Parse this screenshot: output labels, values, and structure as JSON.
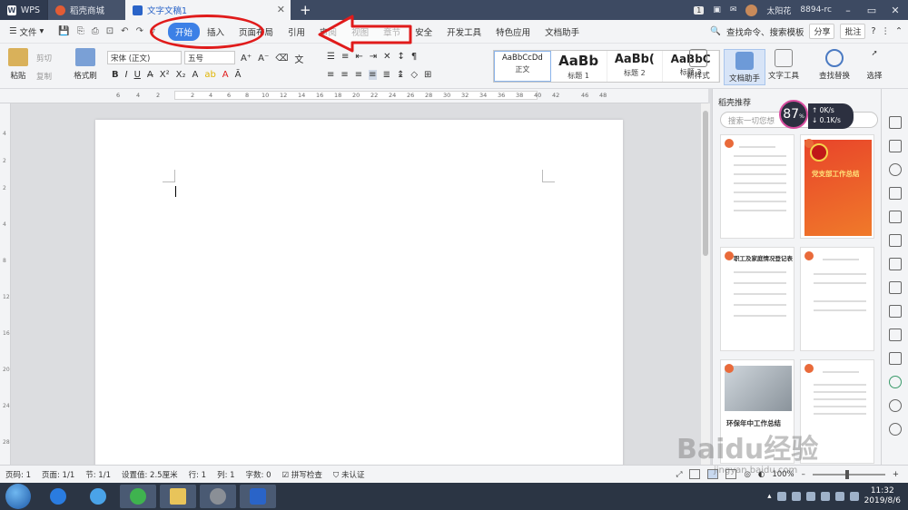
{
  "titlebar": {
    "tabs": [
      {
        "label": "WPS"
      },
      {
        "label": "稻壳商城"
      },
      {
        "label": "文字文稿1"
      }
    ],
    "badge": "1",
    "user_name": "太阳花",
    "user_id": "8894-rc"
  },
  "menubar": {
    "file_label": "文件",
    "tabs": [
      "开始",
      "插入",
      "页面布局",
      "引用",
      "审阅",
      "视图",
      "章节",
      "安全",
      "开发工具",
      "特色应用",
      "文档助手"
    ],
    "active_tab": "开始",
    "search_label": "查找命令、搜索模板",
    "share_label": "分享",
    "comment_label": "批注",
    "help_label": "?"
  },
  "ribbon": {
    "paste": "粘贴",
    "cut": "剪切",
    "copy": "复制",
    "format_painter": "格式刷",
    "font_name": "宋体 (正文)",
    "font_size": "五号",
    "styles": [
      {
        "preview": "AaBbCcDd",
        "label": "正文"
      },
      {
        "preview": "AaBb",
        "label": "标题 1"
      },
      {
        "preview": "AaBb(",
        "label": "标题 2"
      },
      {
        "preview": "AaBbC",
        "label": "标题 3"
      }
    ],
    "new_style": "新样式",
    "doc_helper": "文档助手",
    "text_tools": "文字工具",
    "find_replace": "查找替换",
    "select": "选择"
  },
  "ruler": {
    "ticks": [
      "6",
      "4",
      "2",
      "2",
      "4",
      "6",
      "8",
      "10",
      "12",
      "14",
      "16",
      "18",
      "20",
      "22",
      "24",
      "26",
      "28",
      "30",
      "32",
      "34",
      "36",
      "38",
      "40",
      "42",
      "46",
      "48"
    ]
  },
  "panel": {
    "title": "稻壳推荐",
    "search_placeholder": "搜索一切您想",
    "gauge_value": "87",
    "gauge_unit": "%",
    "upload_speed": "0K/s",
    "download_speed": "0.1K/s",
    "cards": [
      {
        "title": ""
      },
      {
        "title": "党支部工作总结"
      },
      {
        "title": "职工及家庭情况登记表"
      },
      {
        "title": ""
      },
      {
        "title": "环保年中工作总结"
      },
      {
        "title": ""
      }
    ]
  },
  "statusbar": {
    "page_code": "页码: 1",
    "page": "页面: 1/1",
    "section": "节: 1/1",
    "position": "设置值: 2.5厘米",
    "row": "行: 1",
    "col": "列: 1",
    "words": "字数: 0",
    "spellcheck": "拼写检查",
    "cert": "未认证",
    "zoom": "100%"
  },
  "taskbar": {
    "time": "11:32",
    "date": "2019/8/6"
  },
  "watermark": {
    "text": "Baidu经验",
    "url": "jingyan.baidu.com"
  },
  "colors": {
    "accent": "#3c80e6",
    "annotation": "#e01b1b",
    "titlebar": "#3d4a62"
  }
}
